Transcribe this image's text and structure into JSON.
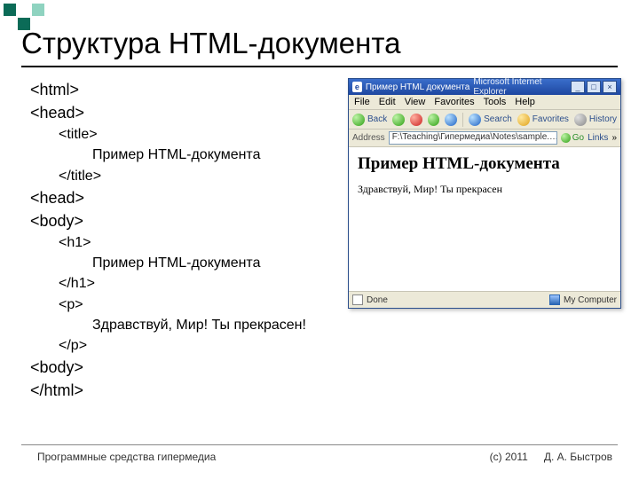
{
  "slide": {
    "title": "Структура HTML-документа"
  },
  "code": {
    "l0a": "<html>",
    "l0b": "<head>",
    "l1a": "<title>",
    "l2a": "Пример HTML-документа",
    "l1b": "</title>",
    "l0c": "<head>",
    "l0d": "<body>",
    "l1c": "<h1>",
    "l2b": "Пример HTML-документа",
    "l1d": "</h1>",
    "l1e": "<p>",
    "l2c": "Здравствуй, Мир! Ты прекрасен!",
    "l1f": "</p>",
    "l0e": "<body>",
    "l0f": "</html>"
  },
  "ie": {
    "title_doc": "Пример HTML документа",
    "title_app": "Microsoft Internet Explorer",
    "favicon_letter": "e",
    "win": {
      "min": "_",
      "max": "□",
      "close": "×"
    },
    "menu": {
      "file": "File",
      "edit": "Edit",
      "view": "View",
      "favorites": "Favorites",
      "tools": "Tools",
      "help": "Help"
    },
    "toolbar": {
      "back": "Back",
      "search": "Search",
      "favorites": "Favorites",
      "history": "History"
    },
    "address": {
      "label": "Address",
      "value": "F:\\Teaching\\Гипермедиа\\Notes\\sample.…",
      "go": "Go",
      "links": "Links",
      "chevron": "»"
    },
    "page": {
      "h1": "Пример HTML-документа",
      "p": "Здравствуй, Мир! Ты прекрасен"
    },
    "status": {
      "left": "Done",
      "right": "My Computer"
    }
  },
  "footer": {
    "left": "Программные средства гипермедиа",
    "copyright": "(с) 2011",
    "author": "Д. А. Быстров"
  }
}
